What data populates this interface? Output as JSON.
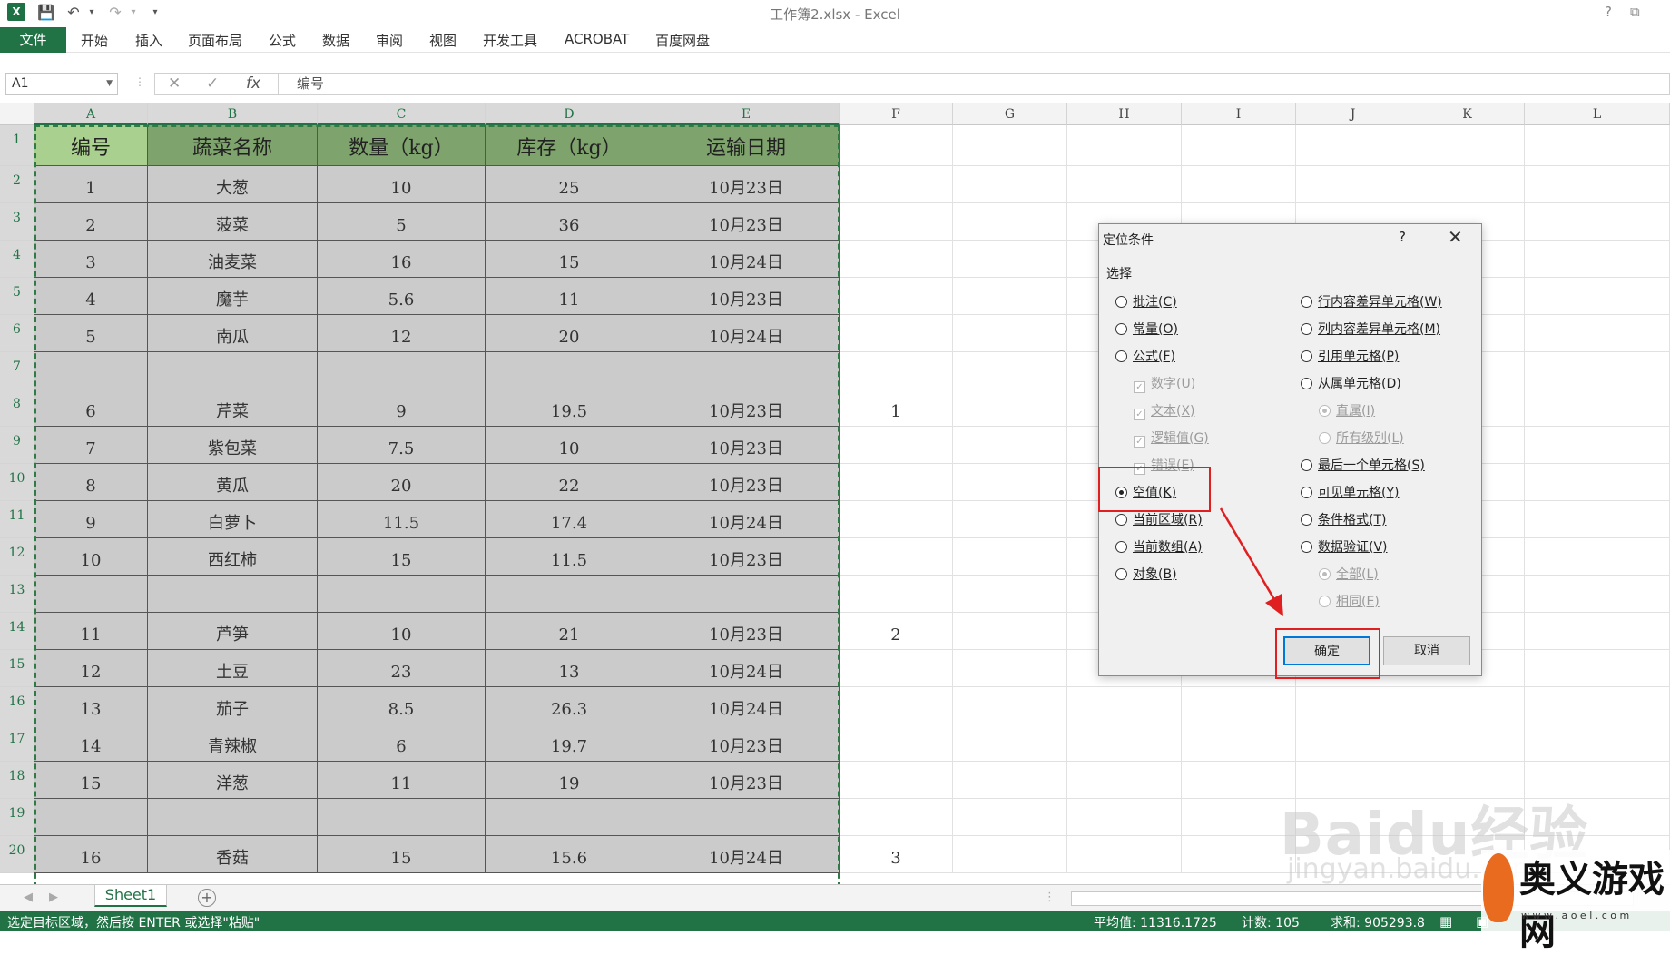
{
  "app": {
    "title": "工作簿2.xlsx - Excel",
    "excel_logo": "X",
    "qa_save": "💾",
    "qa_undo": "↶",
    "qa_redo": "↷",
    "qa_more": "▾",
    "help": "?",
    "restore": "⧉"
  },
  "ribbon": {
    "file": "文件",
    "tabs": [
      "开始",
      "插入",
      "页面布局",
      "公式",
      "数据",
      "审阅",
      "视图",
      "开发工具",
      "ACROBAT",
      "百度网盘"
    ]
  },
  "formula_bar": {
    "name_box": "A1",
    "cancel": "✕",
    "enter": "✓",
    "fx": "fx",
    "content": "编号"
  },
  "columns": [
    "A",
    "B",
    "C",
    "D",
    "E",
    "F",
    "G",
    "H",
    "I",
    "J",
    "K",
    "L"
  ],
  "rows": [
    "1",
    "2",
    "3",
    "4",
    "5",
    "6",
    "7",
    "8",
    "9",
    "10",
    "11",
    "12",
    "13",
    "14",
    "15",
    "16",
    "17",
    "18",
    "19",
    "20"
  ],
  "table": {
    "headers": [
      "编号",
      "蔬菜名称",
      "数量（kg）",
      "库存（kg）",
      "运输日期"
    ],
    "rows": [
      [
        "1",
        "大葱",
        "10",
        "25",
        "10月23日"
      ],
      [
        "2",
        "菠菜",
        "5",
        "36",
        "10月23日"
      ],
      [
        "3",
        "油麦菜",
        "16",
        "15",
        "10月24日"
      ],
      [
        "4",
        "魔芋",
        "5.6",
        "11",
        "10月23日"
      ],
      [
        "5",
        "南瓜",
        "12",
        "20",
        "10月24日"
      ],
      [
        "",
        "",
        "",
        "",
        ""
      ],
      [
        "6",
        "芹菜",
        "9",
        "19.5",
        "10月23日"
      ],
      [
        "7",
        "紫包菜",
        "7.5",
        "10",
        "10月23日"
      ],
      [
        "8",
        "黄瓜",
        "20",
        "22",
        "10月23日"
      ],
      [
        "9",
        "白萝卜",
        "11.5",
        "17.4",
        "10月24日"
      ],
      [
        "10",
        "西红柿",
        "15",
        "11.5",
        "10月23日"
      ],
      [
        "",
        "",
        "",
        "",
        ""
      ],
      [
        "11",
        "芦笋",
        "10",
        "21",
        "10月23日"
      ],
      [
        "12",
        "土豆",
        "23",
        "13",
        "10月24日"
      ],
      [
        "13",
        "茄子",
        "8.5",
        "26.3",
        "10月24日"
      ],
      [
        "14",
        "青辣椒",
        "6",
        "19.7",
        "10月23日"
      ],
      [
        "15",
        "洋葱",
        "11",
        "19",
        "10月23日"
      ],
      [
        "",
        "",
        "",
        "",
        ""
      ],
      [
        "16",
        "香菇",
        "15",
        "15.6",
        "10月24日"
      ]
    ]
  },
  "f_column": {
    "row8": "1",
    "row14": "2",
    "row20": "3"
  },
  "sheets": {
    "active": "Sheet1",
    "add": "+",
    "prev": "◀",
    "next": "▶"
  },
  "status": {
    "message": "选定目标区域，然后按 ENTER 或选择\"粘贴\"",
    "average": "平均值: 11316.1725",
    "count": "计数: 105",
    "sum": "求和: 905293.8"
  },
  "dialog": {
    "title": "定位条件",
    "help": "?",
    "close": "✕",
    "group": "选择",
    "left_options": [
      {
        "label": "批注",
        "key": "(C)",
        "type": "radio",
        "checked": false,
        "disabled": false
      },
      {
        "label": "常量",
        "key": "(O)",
        "type": "radio",
        "checked": false,
        "disabled": false
      },
      {
        "label": "公式",
        "key": "(F)",
        "type": "radio",
        "checked": false,
        "disabled": false
      },
      {
        "label": "数字",
        "key": "(U)",
        "type": "check",
        "checked": true,
        "disabled": true
      },
      {
        "label": "文本",
        "key": "(X)",
        "type": "check",
        "checked": true,
        "disabled": true
      },
      {
        "label": "逻辑值",
        "key": "(G)",
        "type": "check",
        "checked": true,
        "disabled": true
      },
      {
        "label": "错误",
        "key": "(E)",
        "type": "check",
        "checked": true,
        "disabled": true
      },
      {
        "label": "空值",
        "key": "(K)",
        "type": "radio",
        "checked": true,
        "disabled": false
      },
      {
        "label": "当前区域",
        "key": "(R)",
        "type": "radio",
        "checked": false,
        "disabled": false
      },
      {
        "label": "当前数组",
        "key": "(A)",
        "type": "radio",
        "checked": false,
        "disabled": false
      },
      {
        "label": "对象",
        "key": "(B)",
        "type": "radio",
        "checked": false,
        "disabled": false
      }
    ],
    "right_options": [
      {
        "label": "行内容差异单元格",
        "key": "(W)",
        "type": "radio",
        "checked": false,
        "disabled": false
      },
      {
        "label": "列内容差异单元格",
        "key": "(M)",
        "type": "radio",
        "checked": false,
        "disabled": false
      },
      {
        "label": "引用单元格",
        "key": "(P)",
        "type": "radio",
        "checked": false,
        "disabled": false
      },
      {
        "label": "从属单元格",
        "key": "(D)",
        "type": "radio",
        "checked": false,
        "disabled": false
      },
      {
        "label": "直属",
        "key": "(I)",
        "type": "radio",
        "checked": true,
        "disabled": true
      },
      {
        "label": "所有级别",
        "key": "(L)",
        "type": "radio",
        "checked": false,
        "disabled": true
      },
      {
        "label": "最后一个单元格",
        "key": "(S)",
        "type": "radio",
        "checked": false,
        "disabled": false
      },
      {
        "label": "可见单元格",
        "key": "(Y)",
        "type": "radio",
        "checked": false,
        "disabled": false
      },
      {
        "label": "条件格式",
        "key": "(T)",
        "type": "radio",
        "checked": false,
        "disabled": false
      },
      {
        "label": "数据验证",
        "key": "(V)",
        "type": "radio",
        "checked": false,
        "disabled": false
      },
      {
        "label": "全部",
        "key": "(L)",
        "type": "radio",
        "checked": true,
        "disabled": true
      },
      {
        "label": "相同",
        "key": "(E)",
        "type": "radio",
        "checked": false,
        "disabled": true
      }
    ],
    "ok": "确定",
    "cancel": "取消"
  },
  "watermarks": {
    "baidu": "Baidu经验",
    "baidu_url": "jingyan.baidu.com",
    "site_name": "奥义游戏网",
    "site_url": "w w w . a o e l . c o m"
  },
  "colors": {
    "excel_green": "#217346",
    "header_green": "#7fa36d",
    "header_first": "#a9d08e",
    "table_gray": "#cbcbcb",
    "annotation_red": "#e02020"
  }
}
